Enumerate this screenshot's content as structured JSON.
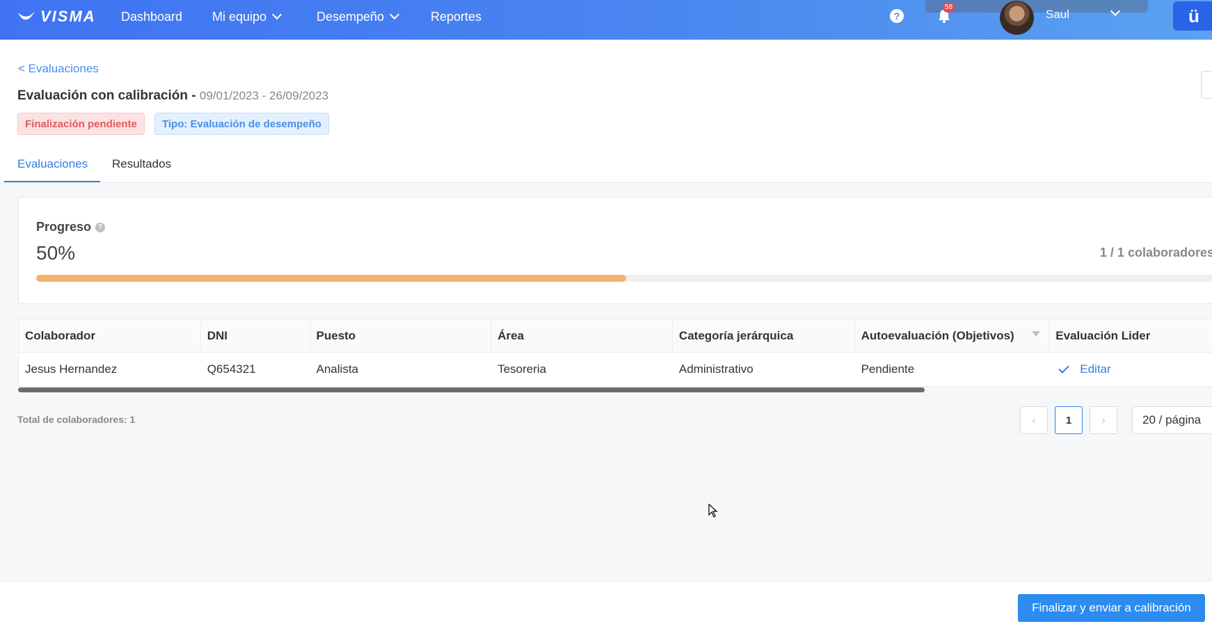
{
  "brand": {
    "logo_text": "VISMA",
    "accent": "#3f73f2"
  },
  "nav": {
    "items": [
      {
        "label": "Dashboard",
        "has_dropdown": false
      },
      {
        "label": "Mi equipo",
        "has_dropdown": true
      },
      {
        "label": "Desempeño",
        "has_dropdown": true
      },
      {
        "label": "Reportes",
        "has_dropdown": false
      }
    ],
    "notification_count": "58",
    "user_name": "Saul",
    "app_badge": "ü"
  },
  "header": {
    "back_label": "< Evaluaciones",
    "title": "Evaluación con calibración -",
    "dates": "09/01/2023 - 26/09/2023",
    "tags": [
      {
        "label": "Finalización pendiente",
        "color": "#e0595f"
      },
      {
        "label": "Tipo: Evaluación de desempeño",
        "color": "#4a8fe8"
      }
    ]
  },
  "tabs": [
    {
      "label": "Evaluaciones",
      "active": true
    },
    {
      "label": "Resultados",
      "active": false
    }
  ],
  "progress": {
    "label": "Progreso",
    "value_text": "50%",
    "fraction": 0.5,
    "count_text": "1 / 1 colaboradores",
    "bar_color": "#f0b46d"
  },
  "table": {
    "columns": [
      "Colaborador",
      "DNI",
      "Puesto",
      "Área",
      "Categoría jerárquica",
      "Autoevaluación (Objetivos)",
      "Evaluación Lider"
    ],
    "rows": [
      {
        "colaborador": "Jesus Hernandez",
        "dni": "Q654321",
        "puesto": "Analista",
        "area": "Tesoreria",
        "categoria": "Administrativo",
        "autoevaluacion": "Pendiente",
        "evaluacion_lider": "Editar"
      }
    ]
  },
  "pagination": {
    "total_text": "Total de colaboradores: 1",
    "current_page": "1",
    "page_size": "20 / página"
  },
  "footer": {
    "primary_button": "Finalizar y enviar a calibración"
  }
}
